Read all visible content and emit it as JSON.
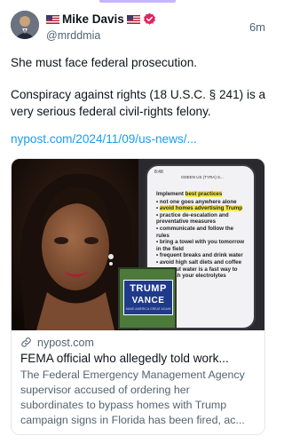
{
  "post": {
    "author_name": "Mike Davis",
    "author_handle": "@mrddmia",
    "timestamp": "6m",
    "text_line_1": "She must face federal prosecution.",
    "text_line_2": "Conspiracy against rights (18 U.S.C. § 241) is a very serious federal civil-rights felony.",
    "link_text": "nypost.com/2024/11/09/us-news/..."
  },
  "card": {
    "domain": "nypost.com",
    "title": "FEMA official who allegedly told work...",
    "description": "The Federal Emergency Management Agency supervisor accused of ordering her subordinates to bypass homes with Trump campaign signs in Florida has been fired, ac...",
    "image": {
      "phone_status": "8:48",
      "phone_contact": "ODEEN US (TYRA) S...",
      "note_heading_plain": "Implement ",
      "note_heading_highlight": "best practices",
      "note_items": [
        {
          "text": "not one goes anywhere alone"
        },
        {
          "text": "avoid homes advertising Trump",
          "highlight": true
        },
        {
          "text": "practice de-escalation and preventative measures"
        },
        {
          "text": "communicate and follow the rules"
        },
        {
          "text": "bring a towel with you tomorrow in the field"
        },
        {
          "text": "frequent breaks and drink water"
        },
        {
          "text": "avoid high salt diets and coffee"
        },
        {
          "text": "coconut water is a fast way to replenish your electrolytes quickly"
        }
      ],
      "sign_line_1": "TRUMP",
      "sign_line_2": "VANCE",
      "sign_line_3": "MAKE AMERICA GREAT AGAIN"
    }
  },
  "icons": {
    "avatar": "avatar",
    "flag": "us-flag-icon",
    "verified": "verified-badge-icon",
    "link": "link-icon"
  },
  "colors": {
    "link": "#1d9bf0",
    "secondary_text": "#536471",
    "verified": "#e0245e",
    "accent_bar": "#c4b5fd",
    "highlight": "#f7e94b"
  }
}
